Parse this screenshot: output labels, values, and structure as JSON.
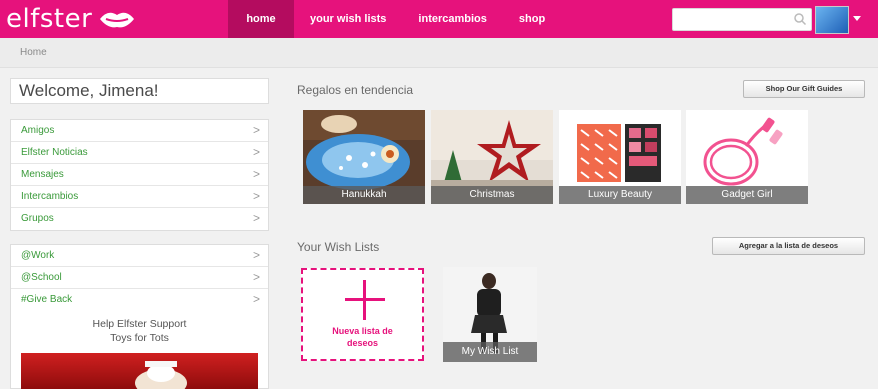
{
  "header": {
    "logo_text": "elfster",
    "nav": [
      {
        "label": "home",
        "active": true
      },
      {
        "label": "your wish lists",
        "active": false
      },
      {
        "label": "intercambios",
        "active": false
      },
      {
        "label": "shop",
        "active": false
      }
    ],
    "search_placeholder": "",
    "brand_color": "#e6127c"
  },
  "breadcrumb": "Home",
  "sidebar": {
    "welcome": "Welcome, Jimena!",
    "menu1": [
      "Amigos",
      "Elfster Noticias",
      "Mensajes",
      "Intercambios",
      "Grupos"
    ],
    "menu2": [
      "@Work",
      "@School",
      "#Give Back"
    ],
    "support_line1": "Help Elfster Support",
    "support_line2": "Toys for Tots"
  },
  "trending": {
    "title": "Regalos en tendencia",
    "button": "Shop Our Gift Guides",
    "tiles": [
      "Hanukkah",
      "Christmas",
      "Luxury Beauty",
      "Gadget Girl"
    ]
  },
  "wishlists": {
    "title": "Your Wish Lists",
    "button": "Agregar a la lista de deseos",
    "new_label_1": "Nueva lista de",
    "new_label_2": "deseos",
    "list_name": "My Wish List"
  }
}
